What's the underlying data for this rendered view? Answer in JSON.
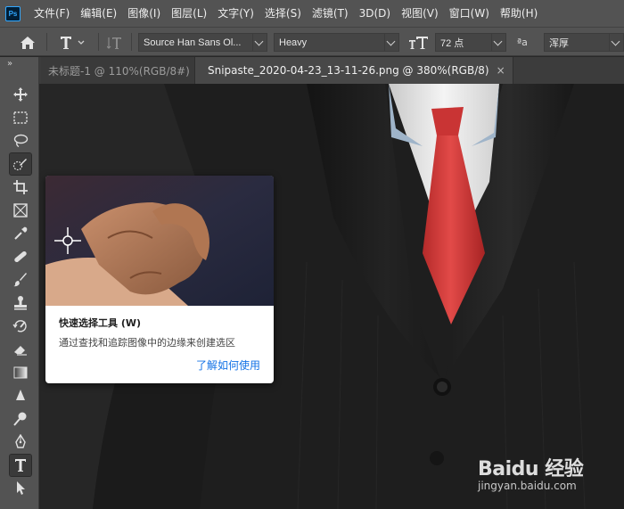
{
  "app": {
    "logo_text": "Ps"
  },
  "menu": [
    "文件(F)",
    "编辑(E)",
    "图像(I)",
    "图层(L)",
    "文字(Y)",
    "选择(S)",
    "滤镜(T)",
    "3D(D)",
    "视图(V)",
    "窗口(W)",
    "帮助(H)"
  ],
  "options": {
    "font_family": "Source Han Sans Ol...",
    "font_style": "Heavy",
    "font_size": "72 点",
    "antialias_label": "ªa",
    "antialias": "浑厚"
  },
  "tabs": [
    {
      "label": "未标题-1 @ 110%(RGB/8#)",
      "close": "×",
      "active": false
    },
    {
      "label": "Snipaste_2020-04-23_13-11-26.png @ 380%(RGB/8)",
      "close": "×",
      "active": true
    }
  ],
  "tooltip": {
    "title": "快速选择工具 (W)",
    "description": "通过查找和追踪图像中的边缘来创建选区",
    "link": "了解如何使用"
  },
  "watermark": {
    "logo": "Baidu 经验",
    "url": "jingyan.baidu.com"
  },
  "colors": {
    "menubar_bg": "#535353",
    "canvas_bg": "#262626",
    "tie_red": "#d93a3a",
    "link_blue": "#1473e6"
  },
  "icons": [
    "move-icon",
    "marquee-icon",
    "lasso-icon",
    "quick-select-icon",
    "crop-icon",
    "frame-icon",
    "eyedropper-icon",
    "healing-icon",
    "brush-icon",
    "stamp-icon",
    "history-brush-icon",
    "eraser-icon",
    "gradient-icon",
    "blur-icon",
    "dodge-icon",
    "pen-icon",
    "type-icon",
    "path-select-icon"
  ]
}
